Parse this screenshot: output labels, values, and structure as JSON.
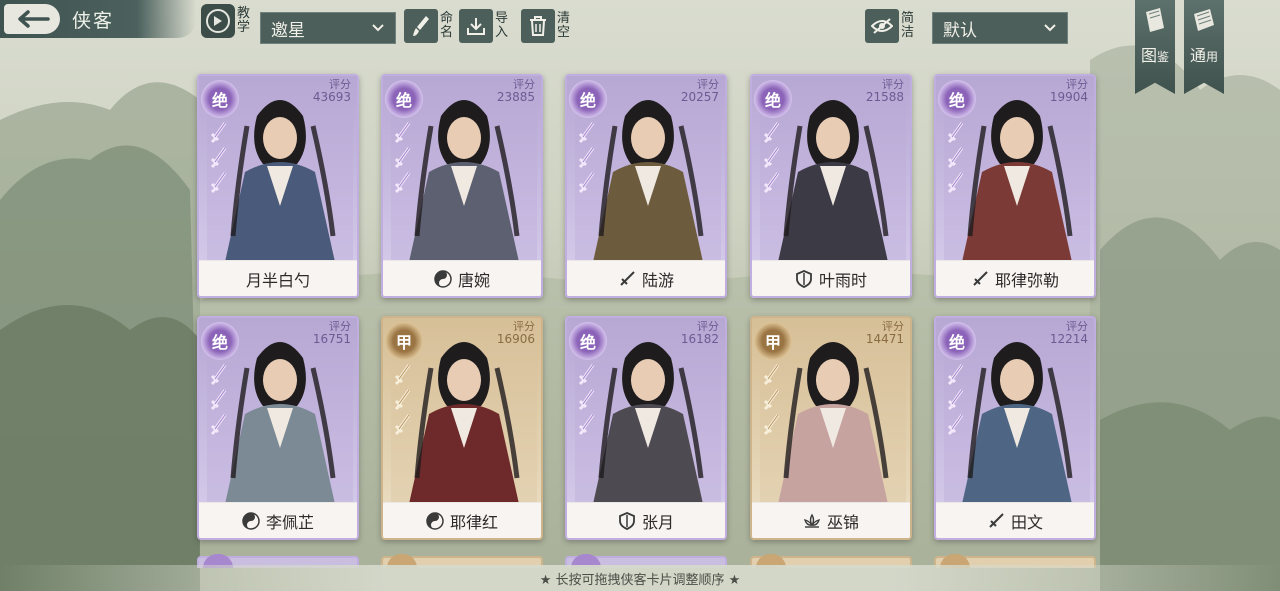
{
  "header": {
    "title": "侠客",
    "tutorial_label": [
      "教",
      "学"
    ],
    "filter_dropdown": "邀星",
    "rename_label": [
      "命",
      "名"
    ],
    "import_label": [
      "导",
      "入"
    ],
    "clear_label": [
      "清",
      "空"
    ],
    "compact_label": [
      "简",
      "洁"
    ],
    "sort_dropdown": "默认",
    "codex_label": [
      "图",
      "鉴"
    ],
    "general_label": [
      "通",
      "用"
    ]
  },
  "score_label": "评分",
  "cards": [
    {
      "name": "月半白勺",
      "rank": "绝",
      "tier": "jue",
      "score": "43693",
      "class_icon": "none",
      "stars": 3,
      "art": "#4a5a7a"
    },
    {
      "name": "唐婉",
      "rank": "绝",
      "tier": "jue",
      "score": "23885",
      "class_icon": "yin-yang-icon",
      "stars": 3,
      "art": "#5c6070"
    },
    {
      "name": "陆游",
      "rank": "绝",
      "tier": "jue",
      "score": "20257",
      "class_icon": "sword-icon",
      "stars": 3,
      "art": "#6d5b3e"
    },
    {
      "name": "叶雨时",
      "rank": "绝",
      "tier": "jue",
      "score": "21588",
      "class_icon": "shield-icon",
      "stars": 3,
      "art": "#3c3a44"
    },
    {
      "name": "耶律弥勒",
      "rank": "绝",
      "tier": "jue",
      "score": "19904",
      "class_icon": "sword-icon",
      "stars": 3,
      "art": "#7b3a35"
    },
    {
      "name": "李佩芷",
      "rank": "绝",
      "tier": "jue",
      "score": "16751",
      "class_icon": "yin-yang-icon",
      "stars": 3,
      "art": "#7c8a96"
    },
    {
      "name": "耶律红",
      "rank": "甲",
      "tier": "jia",
      "score": "16906",
      "class_icon": "yin-yang-icon",
      "stars": 3,
      "art": "#6e2a2a"
    },
    {
      "name": "张月",
      "rank": "绝",
      "tier": "jue",
      "score": "16182",
      "class_icon": "shield-icon",
      "stars": 3,
      "art": "#4d4a52"
    },
    {
      "name": "巫锦",
      "rank": "甲",
      "tier": "jia",
      "score": "14471",
      "class_icon": "lotus-icon",
      "stars": 3,
      "art": "#c7a3a0"
    },
    {
      "name": "田文",
      "rank": "绝",
      "tier": "jue",
      "score": "12214",
      "class_icon": "sword-icon",
      "stars": 3,
      "art": "#4e6584"
    }
  ],
  "partial_row": [
    "jue",
    "jia",
    "jue",
    "jia",
    "jia"
  ],
  "footer_hint": "★ 长按可拖拽侠客卡片调整顺序 ★",
  "colors": {
    "jue_accent": "#8b63b8",
    "jia_accent": "#9a7443",
    "toolbar_bg": "#4c5f5a"
  }
}
